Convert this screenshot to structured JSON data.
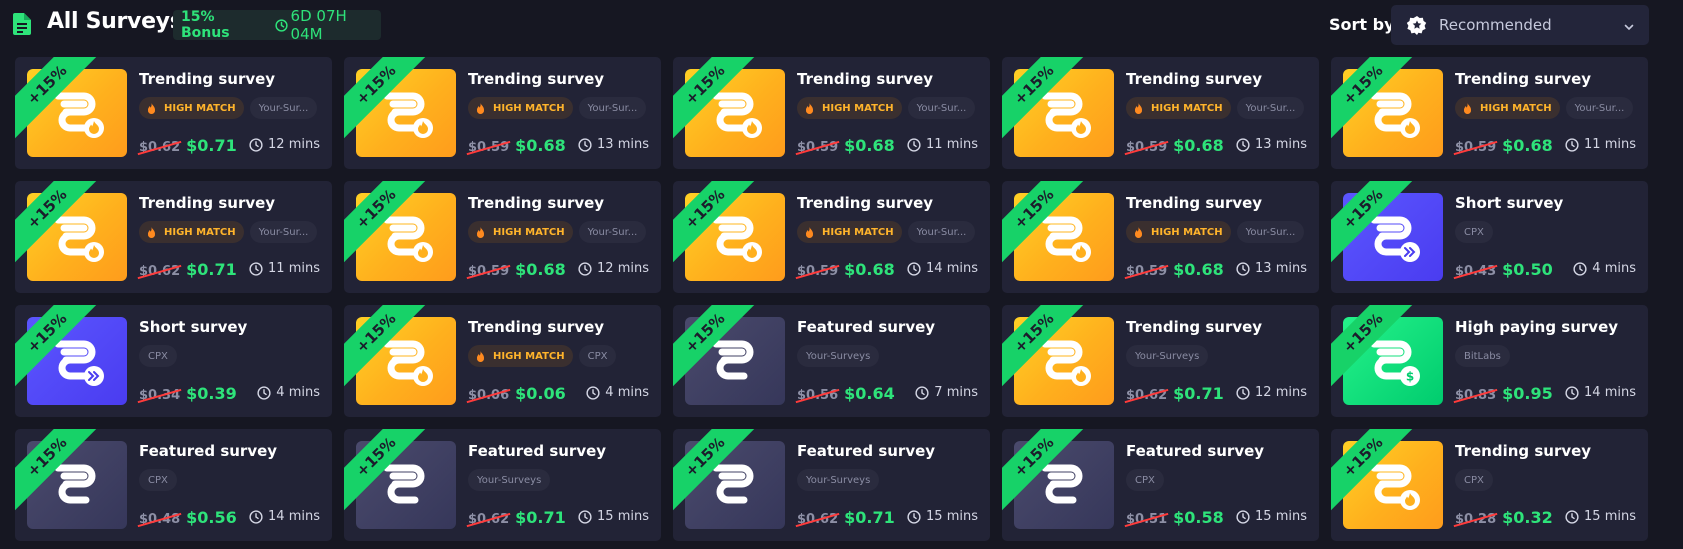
{
  "header": {
    "title": "All Surveys",
    "bonus_label": "15% Bonus",
    "timer": "6D 07H 04M",
    "sort_label": "Sort by",
    "sort_value": "Recommended"
  },
  "colors": {
    "accent_green": "#2ee37a",
    "ribbon_green": "#17d268",
    "match_orange": "#ffb42b",
    "strike_red": "#ff3b3b",
    "background": "#161722",
    "card": "#222336"
  },
  "surveys": [
    {
      "title": "Trending survey",
      "ribbon": "+15%",
      "match": "HIGH MATCH",
      "provider": "Your-Sur...",
      "old_price": "$0.62",
      "new_price": "$0.71",
      "duration": "12 mins",
      "theme": "gold",
      "icon": "survey-flame-icon"
    },
    {
      "title": "Trending survey",
      "ribbon": "+15%",
      "match": "HIGH MATCH",
      "provider": "Your-Sur...",
      "old_price": "$0.59",
      "new_price": "$0.68",
      "duration": "13 mins",
      "theme": "gold",
      "icon": "survey-flame-icon"
    },
    {
      "title": "Trending survey",
      "ribbon": "+15%",
      "match": "HIGH MATCH",
      "provider": "Your-Sur...",
      "old_price": "$0.59",
      "new_price": "$0.68",
      "duration": "11 mins",
      "theme": "gold",
      "icon": "survey-flame-icon"
    },
    {
      "title": "Trending survey",
      "ribbon": "+15%",
      "match": "HIGH MATCH",
      "provider": "Your-Sur...",
      "old_price": "$0.59",
      "new_price": "$0.68",
      "duration": "13 mins",
      "theme": "gold",
      "icon": "survey-flame-icon"
    },
    {
      "title": "Trending survey",
      "ribbon": "+15%",
      "match": "HIGH MATCH",
      "provider": "Your-Sur...",
      "old_price": "$0.59",
      "new_price": "$0.68",
      "duration": "11 mins",
      "theme": "gold",
      "icon": "survey-flame-icon"
    },
    {
      "title": "Trending survey",
      "ribbon": "+15%",
      "match": "HIGH MATCH",
      "provider": "Your-Sur...",
      "old_price": "$0.62",
      "new_price": "$0.71",
      "duration": "11 mins",
      "theme": "gold",
      "icon": "survey-flame-icon"
    },
    {
      "title": "Trending survey",
      "ribbon": "+15%",
      "match": "HIGH MATCH",
      "provider": "Your-Sur...",
      "old_price": "$0.59",
      "new_price": "$0.68",
      "duration": "12 mins",
      "theme": "gold",
      "icon": "survey-flame-icon"
    },
    {
      "title": "Trending survey",
      "ribbon": "+15%",
      "match": "HIGH MATCH",
      "provider": "Your-Sur...",
      "old_price": "$0.59",
      "new_price": "$0.68",
      "duration": "14 mins",
      "theme": "gold",
      "icon": "survey-flame-icon"
    },
    {
      "title": "Trending survey",
      "ribbon": "+15%",
      "match": "HIGH MATCH",
      "provider": "Your-Sur...",
      "old_price": "$0.59",
      "new_price": "$0.68",
      "duration": "13 mins",
      "theme": "gold",
      "icon": "survey-flame-icon"
    },
    {
      "title": "Short survey",
      "ribbon": "+15%",
      "match": "",
      "provider": "CPX",
      "old_price": "$0.43",
      "new_price": "$0.50",
      "duration": "4 mins",
      "theme": "blue",
      "icon": "survey-fast-icon"
    },
    {
      "title": "Short survey",
      "ribbon": "+15%",
      "match": "",
      "provider": "CPX",
      "old_price": "$0.34",
      "new_price": "$0.39",
      "duration": "4 mins",
      "theme": "blue",
      "icon": "survey-fast-icon"
    },
    {
      "title": "Trending survey",
      "ribbon": "+15%",
      "match": "HIGH MATCH",
      "provider": "CPX",
      "old_price": "$0.06",
      "new_price": "$0.06",
      "duration": "4 mins",
      "theme": "gold",
      "icon": "survey-flame-icon"
    },
    {
      "title": "Featured survey",
      "ribbon": "+15%",
      "match": "",
      "provider": "Your-Surveys",
      "old_price": "$0.56",
      "new_price": "$0.64",
      "duration": "7 mins",
      "theme": "dark",
      "icon": "survey-logo-icon"
    },
    {
      "title": "Trending survey",
      "ribbon": "+15%",
      "match": "",
      "provider": "Your-Surveys",
      "old_price": "$0.62",
      "new_price": "$0.71",
      "duration": "12 mins",
      "theme": "gold",
      "icon": "survey-flame-icon"
    },
    {
      "title": "High paying survey",
      "ribbon": "+15%",
      "match": "",
      "provider": "BitLabs",
      "old_price": "$0.83",
      "new_price": "$0.95",
      "duration": "14 mins",
      "theme": "green",
      "icon": "survey-dollar-icon"
    },
    {
      "title": "Featured survey",
      "ribbon": "+15%",
      "match": "",
      "provider": "CPX",
      "old_price": "$0.48",
      "new_price": "$0.56",
      "duration": "14 mins",
      "theme": "dark",
      "icon": "survey-logo-icon"
    },
    {
      "title": "Featured survey",
      "ribbon": "+15%",
      "match": "",
      "provider": "Your-Surveys",
      "old_price": "$0.62",
      "new_price": "$0.71",
      "duration": "15 mins",
      "theme": "dark",
      "icon": "survey-logo-icon"
    },
    {
      "title": "Featured survey",
      "ribbon": "+15%",
      "match": "",
      "provider": "Your-Surveys",
      "old_price": "$0.62",
      "new_price": "$0.71",
      "duration": "15 mins",
      "theme": "dark",
      "icon": "survey-logo-icon"
    },
    {
      "title": "Featured survey",
      "ribbon": "+15%",
      "match": "",
      "provider": "CPX",
      "old_price": "$0.51",
      "new_price": "$0.58",
      "duration": "15 mins",
      "theme": "dark",
      "icon": "survey-logo-icon"
    },
    {
      "title": "Trending survey",
      "ribbon": "+15%",
      "match": "",
      "provider": "CPX",
      "old_price": "$0.28",
      "new_price": "$0.32",
      "duration": "15 mins",
      "theme": "gold",
      "icon": "survey-flame-icon"
    }
  ]
}
